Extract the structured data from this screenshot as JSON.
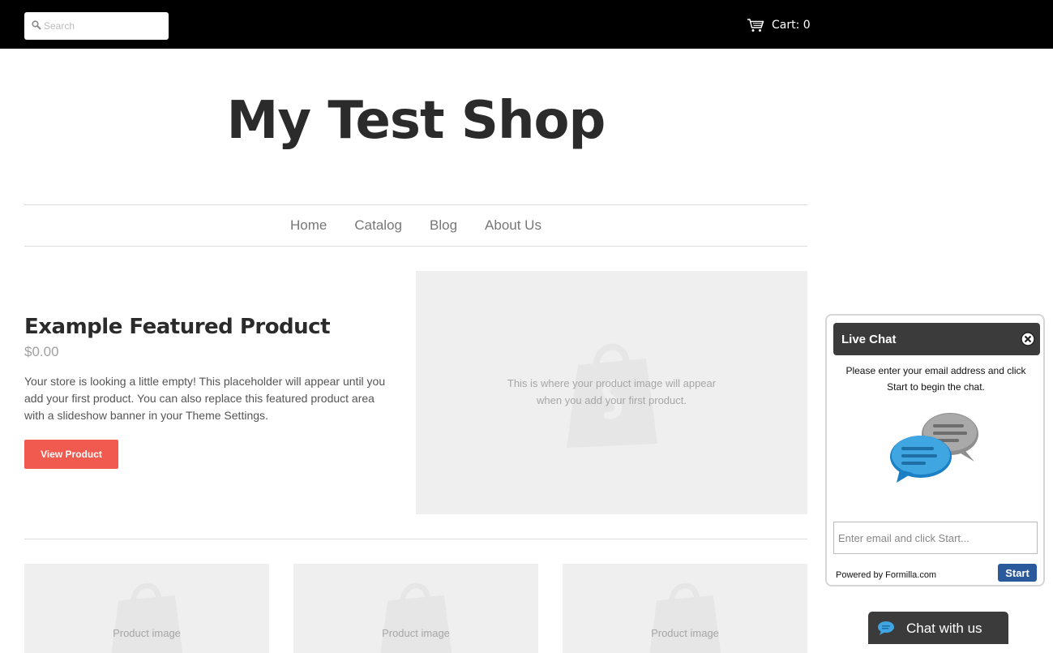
{
  "topbar": {
    "search_placeholder": "Search",
    "cart_label": "Cart: 0"
  },
  "header": {
    "shop_title": "My Test Shop"
  },
  "nav": {
    "items": [
      "Home",
      "Catalog",
      "Blog",
      "About Us"
    ]
  },
  "featured": {
    "title": "Example Featured Product",
    "price": "$0.00",
    "description": "Your store is looking a little empty! This placeholder will appear until you add your first product. You can also replace this featured product area with a slideshow banner in your Theme Settings.",
    "button_label": "View Product",
    "image_text_line1": "This is where your product image will appear",
    "image_text_line2": "when you add your first product."
  },
  "products": {
    "items": [
      {
        "label": "Product image"
      },
      {
        "label": "Product image"
      },
      {
        "label": "Product image"
      }
    ]
  },
  "chat": {
    "title": "Live Chat",
    "intro": "Please enter your email address and click Start to begin the chat.",
    "input_placeholder": "Enter email and click Start...",
    "powered_by": "Powered by Formilla.com",
    "start_label": "Start",
    "tab_label": "Chat with us"
  },
  "colors": {
    "topbar": "#000000",
    "accent_button": "#f15a4f",
    "chat_header": "#3b3b3b",
    "chat_start": "#2a5a9c",
    "placeholder_bg": "#efefef"
  },
  "icons": [
    "search-icon",
    "cart-icon",
    "shopping-bag-icon",
    "close-icon",
    "chat-bubbles-icon",
    "chat-bubble-icon"
  ]
}
